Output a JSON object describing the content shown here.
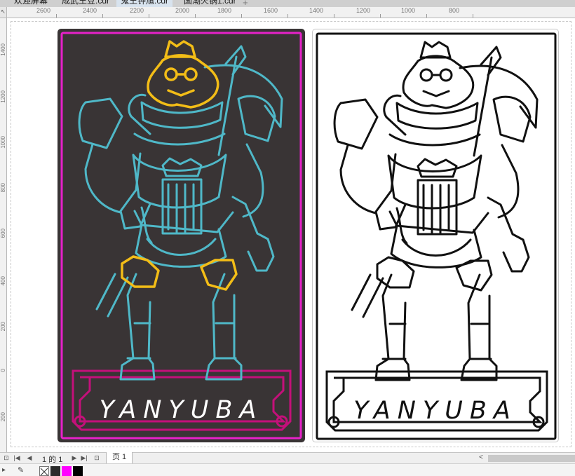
{
  "tabs": [
    {
      "label": "欢迎屏幕",
      "active": false
    },
    {
      "label": "成武王豆.cdr",
      "active": false
    },
    {
      "label": "鬼王钟馗.cdr",
      "active": true
    },
    {
      "label": "国潮火锅1.cdr",
      "active": false
    }
  ],
  "tab_add": "+",
  "ruler_corner": "↖",
  "hruler_labels": [
    "2600",
    "2400",
    "2200",
    "2000",
    "1800",
    "1600",
    "1400",
    "1200",
    "1000",
    "800"
  ],
  "vruler_labels": [
    "1400",
    "1200",
    "1000",
    "800",
    "600",
    "400",
    "200",
    "0",
    "200"
  ],
  "artwork": {
    "neon_brand": "YANYUBA",
    "line_brand": "YANYUBA",
    "colors": {
      "neon_bg": "#393435",
      "neon_cyan": "#4fb8c8",
      "neon_gold": "#f3bd17",
      "neon_magenta": "#e621c9",
      "neon_pink": "#c4107a",
      "line_black": "#111111"
    }
  },
  "pagebar": {
    "first_icon": "first-page-icon",
    "prev_icon": "prev-page-icon",
    "page_count": "1 的 1",
    "next_icon": "next-page-icon",
    "last_icon": "last-page-icon",
    "add_icon": "add-page-icon",
    "page_tab": "页 1",
    "scroll_left": "<"
  },
  "palette": {
    "arrow": "▸",
    "dropper": "dropper-icon",
    "swatches": [
      "#ffffff",
      "#2b2b2b",
      "#ff00ff",
      "#000000"
    ]
  }
}
